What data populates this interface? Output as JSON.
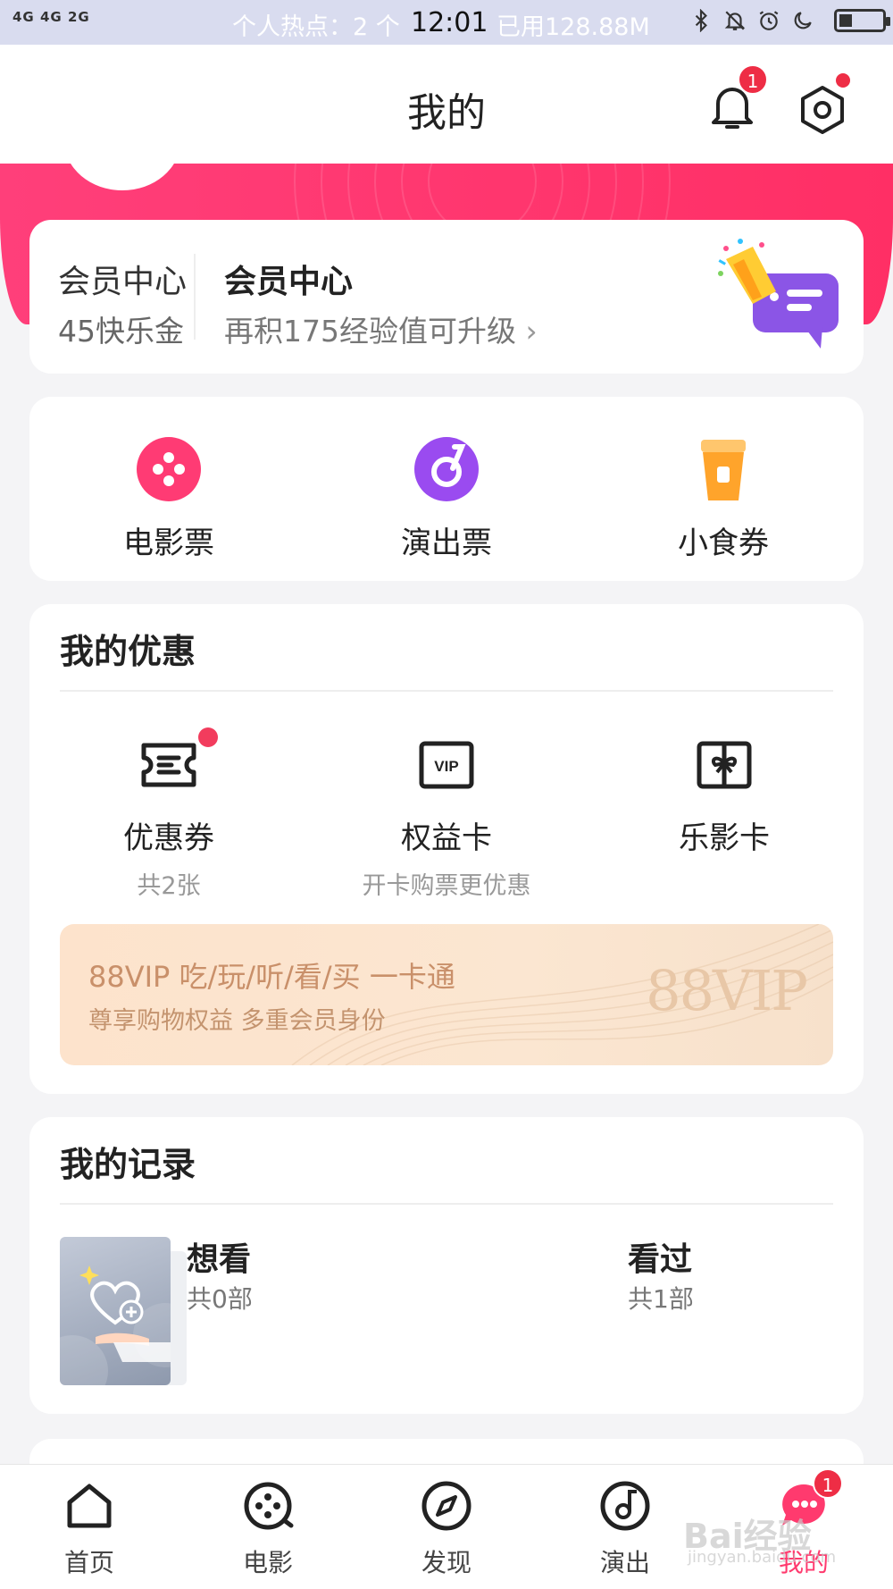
{
  "status_bar": {
    "network": "4G 4G 2G",
    "hotspot": "个人热点：2 个",
    "time": "12:01",
    "data_used": "已用128.88M"
  },
  "header": {
    "title": "我的",
    "notification_count": "1"
  },
  "member": {
    "left_title": "会员中心",
    "left_sub": "45快乐金",
    "title": "会员中心",
    "sub": "再积175经验值可升级",
    "chevron": "›"
  },
  "tickets": [
    {
      "label": "电影票",
      "icon": "film-reel-icon",
      "color": "#ff3b74"
    },
    {
      "label": "演出票",
      "icon": "music-disc-icon",
      "color": "#9a4bf0"
    },
    {
      "label": "小食券",
      "icon": "snack-cup-icon",
      "color": "#ffa42b"
    }
  ],
  "offers": {
    "title": "我的优惠",
    "items": [
      {
        "label": "优惠券",
        "sub": "共2张",
        "icon": "coupon-icon"
      },
      {
        "label": "权益卡",
        "sub": "开卡购票更优惠",
        "icon": "vip-card-icon"
      },
      {
        "label": "乐影卡",
        "sub": "",
        "icon": "gift-card-icon"
      }
    ],
    "vip_banner": {
      "title": "88VIP 吃/玩/听/看/买 一卡通",
      "sub": "尊享购物权益 多重会员身份",
      "logo": "88VIP"
    }
  },
  "records": {
    "title": "我的记录",
    "want": {
      "title": "想看",
      "sub": "共0部"
    },
    "seen": {
      "title": "看过",
      "sub": "共1部"
    }
  },
  "tabbar": [
    {
      "label": "首页",
      "icon": "home-icon"
    },
    {
      "label": "电影",
      "icon": "film-icon"
    },
    {
      "label": "发现",
      "icon": "compass-icon"
    },
    {
      "label": "演出",
      "icon": "music-icon"
    },
    {
      "label": "我的",
      "icon": "profile-icon",
      "badge": "1"
    }
  ],
  "watermark": {
    "text": "Bai经验",
    "sub": "jingyan.baidu.com"
  },
  "colors": {
    "accent": "#ff3a6e",
    "badge": "#ee2d45",
    "vip_text": "#c9906a"
  }
}
